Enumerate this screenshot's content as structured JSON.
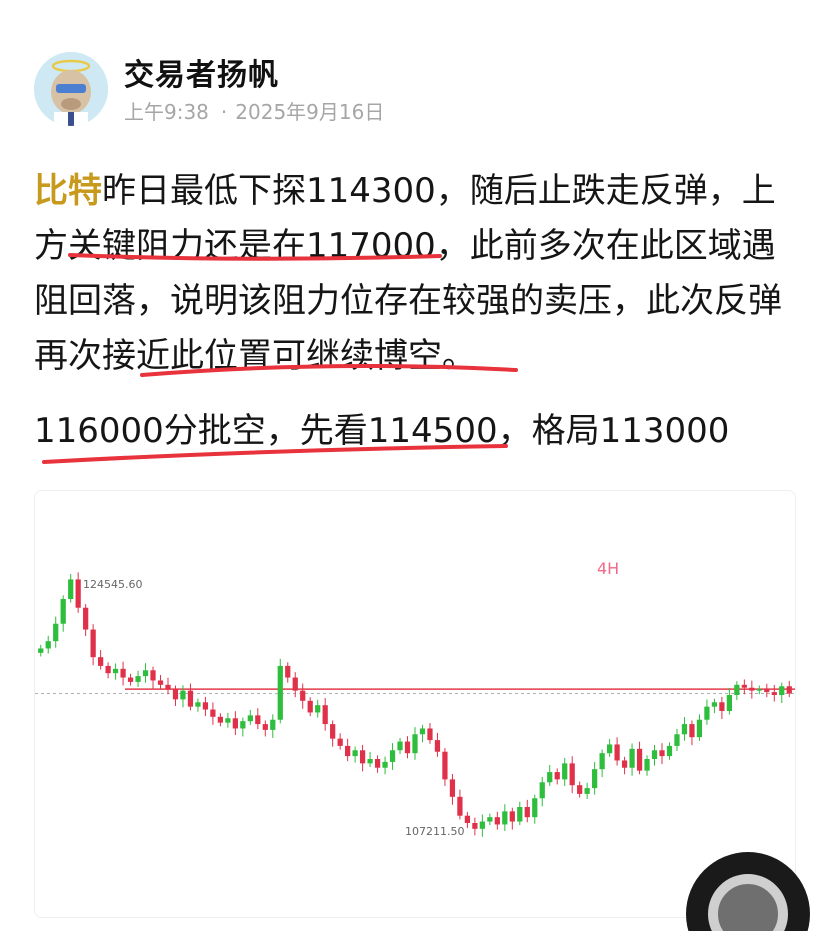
{
  "post": {
    "author": "交易者扬帆",
    "time": "上午9:38",
    "date": "2025年9月16日",
    "paragraph_highlight": "比特",
    "paragraph_rest": "昨日最低下探114300，随后止跌走反弹，上方关键阻力还是在117000，此前多次在此区域遇阻回落，说明该阻力位存在较强的卖压，此次反弹再次接近此位置可继续博空。",
    "plan": "116000分批空，先看114500，格局113000"
  },
  "chart": {
    "timeframe": "4H",
    "high_label": "124545.60",
    "low_label": "107211.50",
    "colors": {
      "up": "#2ebd3c",
      "down": "#e0314b",
      "resistance": "#e23a48",
      "dashed": "#b0b0b0"
    }
  },
  "chart_data": {
    "type": "candlestick",
    "timeframe": "4H",
    "annotations": [
      "124545.60",
      "107211.50"
    ],
    "resistance": 117000,
    "ohlc_close_series": [
      119800,
      120300,
      121500,
      123200,
      124545,
      122600,
      121100,
      119200,
      118600,
      118100,
      118400,
      117800,
      117500,
      117900,
      118300,
      117600,
      117300,
      117000,
      116300,
      116900,
      115800,
      116100,
      115600,
      115100,
      114700,
      115000,
      114300,
      114800,
      115200,
      114600,
      114200,
      114900,
      118600,
      117800,
      116900,
      116200,
      115400,
      115900,
      114600,
      113600,
      113100,
      112400,
      112800,
      111900,
      112200,
      111600,
      112000,
      112800,
      113400,
      112600,
      113900,
      114300,
      113500,
      112700,
      110800,
      109600,
      108300,
      107800,
      107400,
      107900,
      108200,
      107700,
      108600,
      107900,
      108900,
      108200,
      109500,
      110600,
      111300,
      110800,
      111900,
      110400,
      109800,
      110200,
      111500,
      112600,
      113200,
      112100,
      111600,
      112900,
      111400,
      112200,
      112800,
      112400,
      113100,
      113900,
      114600,
      113700,
      114900,
      115800,
      116100,
      115500,
      116600,
      117300,
      117100,
      116900,
      117000,
      116800,
      116600,
      117200,
      116700
    ]
  },
  "icons": {
    "avatar": "avatar-image",
    "floating": "floating-ring-button"
  }
}
